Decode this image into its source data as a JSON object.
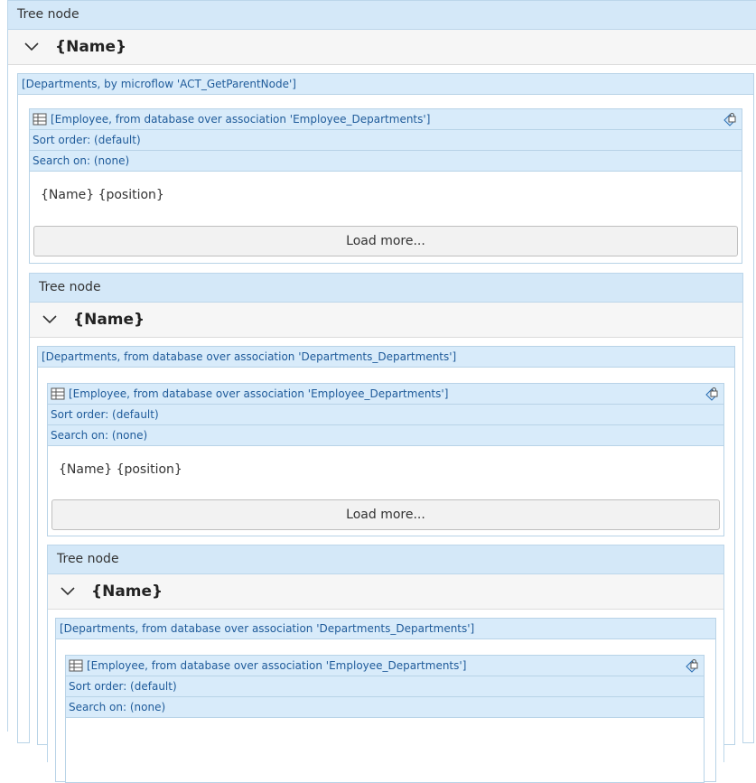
{
  "tree_node_header": "Tree node",
  "node_name": "{Name}",
  "level1": {
    "datasource": "[Departments, by microflow 'ACT_GetParentNode']",
    "list": {
      "source": "[Employee, from database over association 'Employee_Departments']",
      "sort": "Sort order: (default)",
      "search": "Search on: (none)",
      "row": "{Name} {position}",
      "load_more": "Load more..."
    }
  },
  "level2": {
    "datasource": "[Departments, from database over association 'Departments_Departments']",
    "list": {
      "source": "[Employee, from database over association 'Employee_Departments']",
      "sort": "Sort order: (default)",
      "search": "Search on: (none)",
      "row": "{Name} {position}",
      "load_more": "Load more..."
    }
  },
  "level3": {
    "datasource": "[Departments, from database over association 'Departments_Departments']",
    "list": {
      "source": "[Employee, from database over association 'Employee_Departments']",
      "sort": "Sort order: (default)",
      "search": "Search on: (none)"
    }
  },
  "colors": {
    "header_bg": "#d4e8f8",
    "bar_bg": "#d8ebfa",
    "link_text": "#1f5b9a",
    "border": "#b8d3e7"
  }
}
